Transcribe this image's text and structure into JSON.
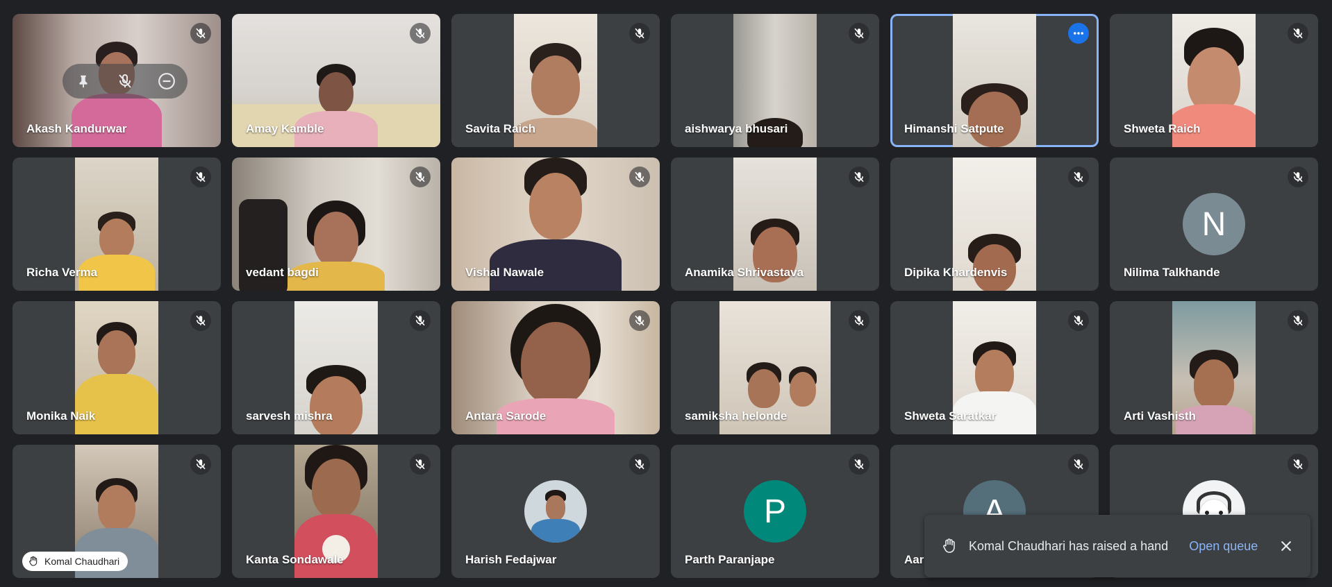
{
  "colors": {
    "background": "#202124",
    "tile": "#3c4043",
    "active_border": "#8ab4f8",
    "link": "#8ab4f8",
    "more_button": "#1a73e8"
  },
  "participants": [
    {
      "name": "Akash Kandurwar",
      "type": "video"
    },
    {
      "name": "Amay Kamble",
      "type": "video"
    },
    {
      "name": "Savita Raich",
      "type": "video"
    },
    {
      "name": "aishwarya bhusari",
      "type": "video"
    },
    {
      "name": "Himanshi Satpute",
      "type": "video"
    },
    {
      "name": "Shweta Raich",
      "type": "video"
    },
    {
      "name": "Richa Verma",
      "type": "video"
    },
    {
      "name": "vedant bagdi",
      "type": "video"
    },
    {
      "name": "Vishal Nawale",
      "type": "video"
    },
    {
      "name": "Anamika Shrivastava",
      "type": "video"
    },
    {
      "name": "Dipika Khardenvis",
      "type": "video"
    },
    {
      "name": "Nilima Talkhande",
      "type": "avatar",
      "initial": "N",
      "avatar_color": "#7b8b94"
    },
    {
      "name": "Monika Naik",
      "type": "video"
    },
    {
      "name": "sarvesh mishra",
      "type": "video"
    },
    {
      "name": "Antara Sarode",
      "type": "video"
    },
    {
      "name": "samiksha helonde",
      "type": "video"
    },
    {
      "name": "Shweta Saratkar",
      "type": "video"
    },
    {
      "name": "Arti Vashisth",
      "type": "video"
    },
    {
      "name": "",
      "type": "video"
    },
    {
      "name": "Kanta Sondawale",
      "type": "video"
    },
    {
      "name": "Harish Fedajwar",
      "type": "avatar-photo"
    },
    {
      "name": "Parth Paranjape",
      "type": "avatar",
      "initial": "P",
      "avatar_color": "#00897b"
    },
    {
      "name": "Aar",
      "type": "avatar",
      "initial": "A",
      "avatar_color": "#546e7a"
    },
    {
      "name": "",
      "type": "avatar-photo"
    }
  ],
  "hand_badge": {
    "name": "Komal Chaudhari"
  },
  "toast": {
    "message": "Komal Chaudhari has raised a hand",
    "action": "Open queue"
  }
}
